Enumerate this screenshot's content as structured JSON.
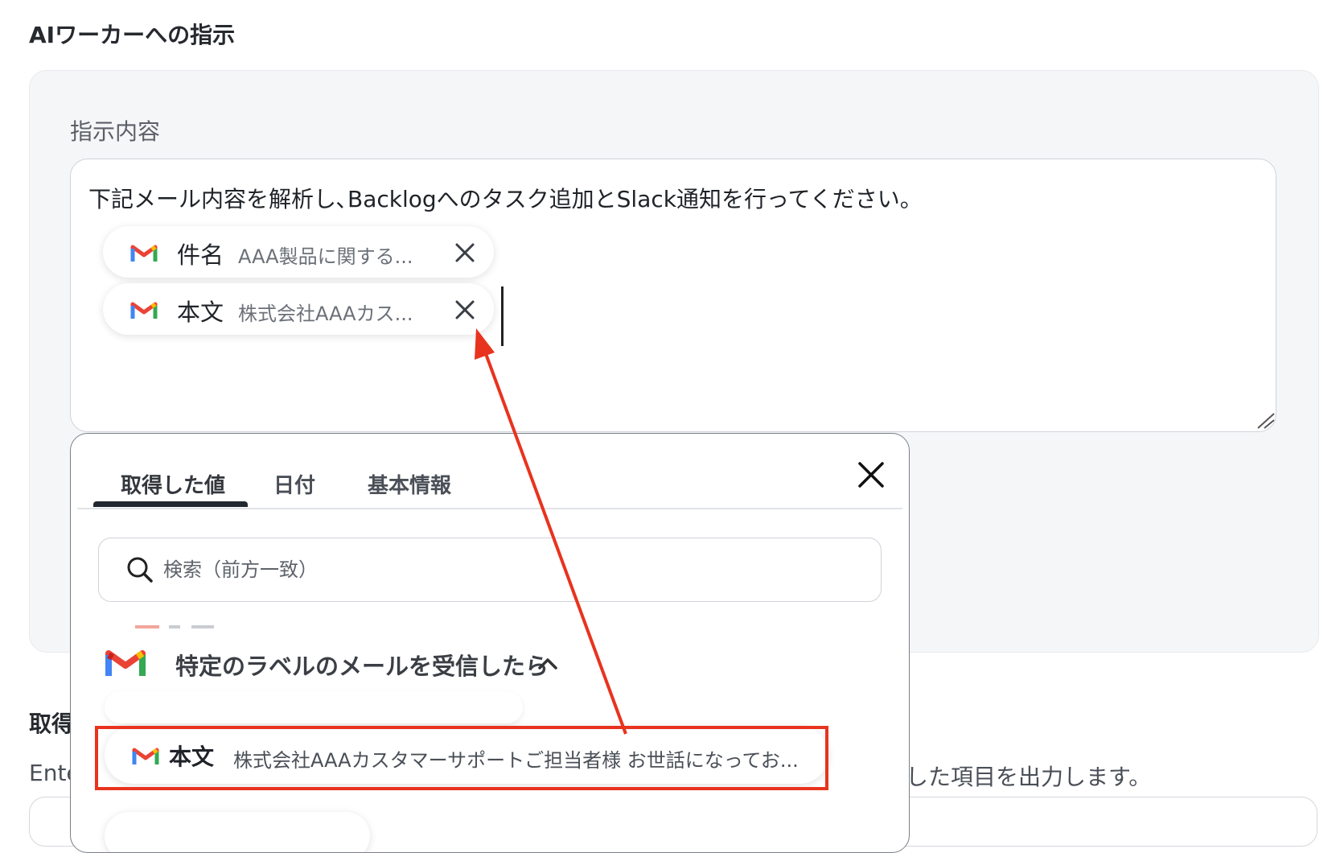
{
  "section": {
    "title": "AIワーカーへの指示"
  },
  "instruction": {
    "label": "指示内容",
    "text": "下記メール内容を解析し､Backlogへのタスク追加とSlack通知を行ってください。",
    "chips": [
      {
        "name": "件名",
        "value": "AAA製品に関する..."
      },
      {
        "name": "本文",
        "value": "株式会社AAAカス..."
      }
    ]
  },
  "popup": {
    "tabs": [
      {
        "label": "取得した値",
        "active": true
      },
      {
        "label": "日付"
      },
      {
        "label": "基本情報"
      }
    ],
    "search_placeholder": "検索（前方一致）",
    "group": {
      "title": "特定のラベルのメールを受信したら"
    },
    "item": {
      "name": "本文",
      "value": "株式会社AAAカスタマーサポートご担当者様 お世話になってお..."
    }
  },
  "below": {
    "title_partial": "取得",
    "desc_partial_start": "Ente",
    "desc_partial_end": "した項目を出力します。"
  },
  "colors": {
    "accent_red": "#e8331e",
    "panel_bg": "#f5f6f8",
    "gmail": [
      "#4285F4",
      "#EA4335",
      "#FBBC04",
      "#34A853",
      "#C5221F"
    ]
  },
  "icons": [
    "gmail-icon",
    "close-icon",
    "search-icon",
    "chevron-up-icon",
    "resize-handle-icon"
  ]
}
